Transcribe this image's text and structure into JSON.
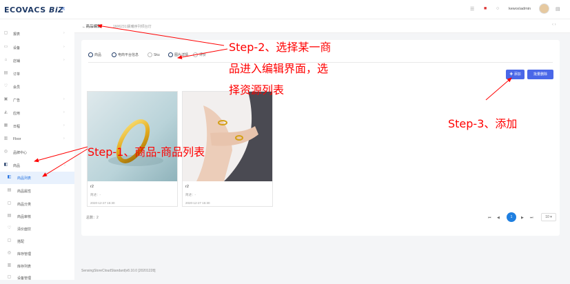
{
  "header": {
    "logo_main": "ECOVACS",
    "logo_sub": "BiZ",
    "collapse_icon": "«",
    "user": "kewos\\admin"
  },
  "sidebar": {
    "items": [
      {
        "label": "报表",
        "icon": "▢"
      },
      {
        "label": "设备",
        "icon": "▭"
      },
      {
        "label": "店铺",
        "icon": "⌂"
      },
      {
        "label": "订单",
        "icon": "▤"
      },
      {
        "label": "会员",
        "icon": "♡"
      },
      {
        "label": "广告",
        "icon": "▣"
      },
      {
        "label": "应用",
        "icon": "◭"
      },
      {
        "label": "日程",
        "icon": "▦"
      },
      {
        "label": "Floor",
        "icon": "▥"
      },
      {
        "label": "品牌中心",
        "icon": "◎"
      },
      {
        "label": "商品",
        "icon": "◧"
      }
    ],
    "subitems": [
      {
        "label": "商品列表",
        "icon": "◧"
      },
      {
        "label": "商品属性",
        "icon": "▤"
      },
      {
        "label": "商品分类",
        "icon": "▢"
      },
      {
        "label": "商品审核",
        "icon": "▤"
      },
      {
        "label": "清价面饮",
        "icon": "♡"
      },
      {
        "label": "搭配",
        "icon": "▢"
      },
      {
        "label": "库存管理",
        "icon": "◎"
      },
      {
        "label": "库存列表",
        "icon": "▥"
      },
      {
        "label": "设备管理",
        "icon": "▢"
      }
    ]
  },
  "breadcrumb": {
    "back": "←商品编辑",
    "path": "1606231|晨曦序列项台灯"
  },
  "tabs": [
    "商品",
    "电商平台信息",
    "Sku",
    "图片详情",
    "评价"
  ],
  "buttons": {
    "add": "✚ 添加",
    "batch_delete": "批量删除"
  },
  "products": [
    {
      "name": "r2",
      "desc": "简述：-",
      "date": "2020-12-27 15:30"
    },
    {
      "name": "r2",
      "desc": "简述：-",
      "date": "2020-12-27 15:30"
    }
  ],
  "total": "总数：2",
  "pagination": {
    "first": "⏮",
    "prev": "◀",
    "current": "1",
    "next": "▶",
    "last": "⏭",
    "page_size": "10 ▾"
  },
  "footer": "SensingStoreCloudStandard|v8.10.0 [20201228]",
  "annotations": {
    "step1": "Step-1、商品-商品列表",
    "step2_line1": "Step-2、选择某一商",
    "step2_line2": "品进入编辑界面，选",
    "step2_line3": "择资源列表",
    "step3": "Step-3、添加"
  }
}
